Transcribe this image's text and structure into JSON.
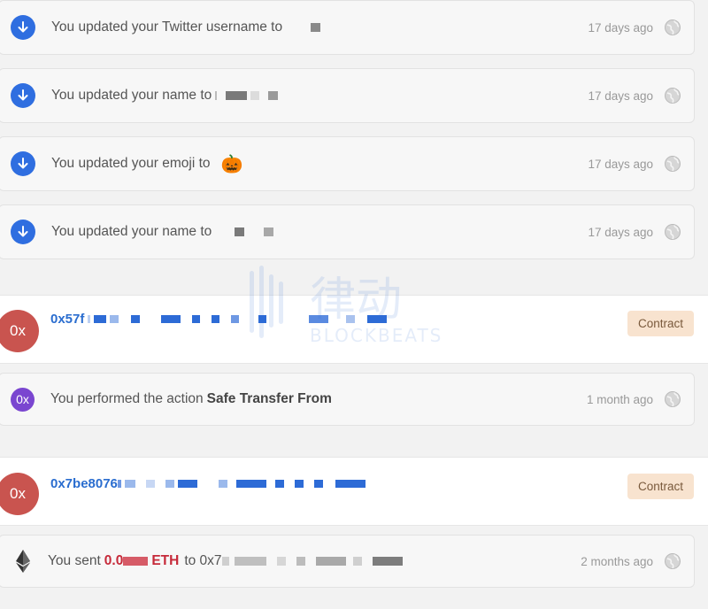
{
  "activity": [
    {
      "text": "You updated your Twitter username to",
      "time": "17 days ago"
    },
    {
      "text": "You updated your name to",
      "time": "17 days ago"
    },
    {
      "text": "You updated your emoji to",
      "emoji": "🎃",
      "time": "17 days ago"
    },
    {
      "text": "You updated your name to",
      "time": "17 days ago"
    }
  ],
  "contract1": {
    "avatar": "0x",
    "address": "0x57f",
    "badge": "Contract",
    "event": {
      "icon": "0x",
      "text": "You performed the action",
      "action": "Safe Transfer From",
      "time": "1 month ago"
    }
  },
  "contract2": {
    "avatar": "0x",
    "address": "0x7be8076",
    "badge": "Contract",
    "event": {
      "text": "You sent",
      "amount": "0.0",
      "currency": "ETH",
      "to": "to 0x7",
      "time": "2 months ago"
    }
  },
  "watermark": {
    "cn": "律动",
    "en": "BLOCKBEATS"
  },
  "colors": {
    "blue": "#2f6ee0",
    "contract_badge": "#f8e3cf",
    "avatar": "#c9544f",
    "purple": "#7a46d0",
    "eth_red": "#c62a3a"
  }
}
